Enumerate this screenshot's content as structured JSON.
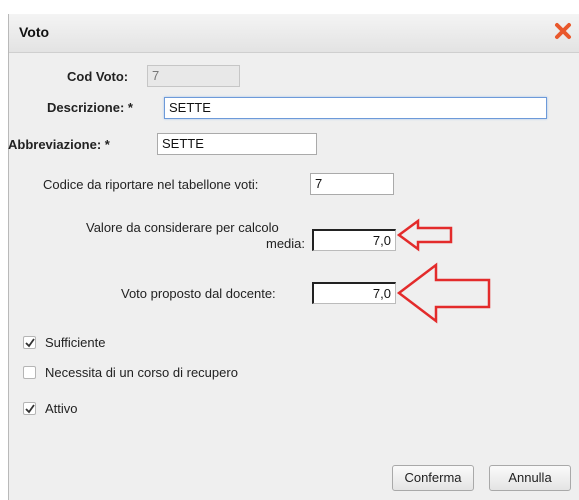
{
  "dialog": {
    "title": "Voto",
    "close_icon": "close-x-icon"
  },
  "form": {
    "cod_voto": {
      "label": "Cod Voto:",
      "value": "7"
    },
    "descrizione": {
      "label": "Descrizione: *",
      "value": "SETTE"
    },
    "abbreviazione": {
      "label": "Abbreviazione: *",
      "value": "SETTE"
    },
    "codice_tabellone": {
      "label": "Codice da riportare nel tabellone voti:",
      "value": "7"
    },
    "valore_media": {
      "label_line1": "Valore da considerare per calcolo",
      "label_line2": "media:",
      "value": "7,0"
    },
    "voto_proposto": {
      "label": "Voto proposto dal docente:",
      "value": "7,0"
    }
  },
  "checkboxes": [
    {
      "label": "Sufficiente",
      "checked": true
    },
    {
      "label": "Necessita di un corso di recupero",
      "checked": false
    },
    {
      "label": "Attivo",
      "checked": true
    }
  ],
  "buttons": {
    "confirm": "Conferma",
    "cancel": "Annulla"
  },
  "annotation": {
    "arrow_color": "#e32b2b",
    "arrow_icon": "arrow-left-icon"
  }
}
